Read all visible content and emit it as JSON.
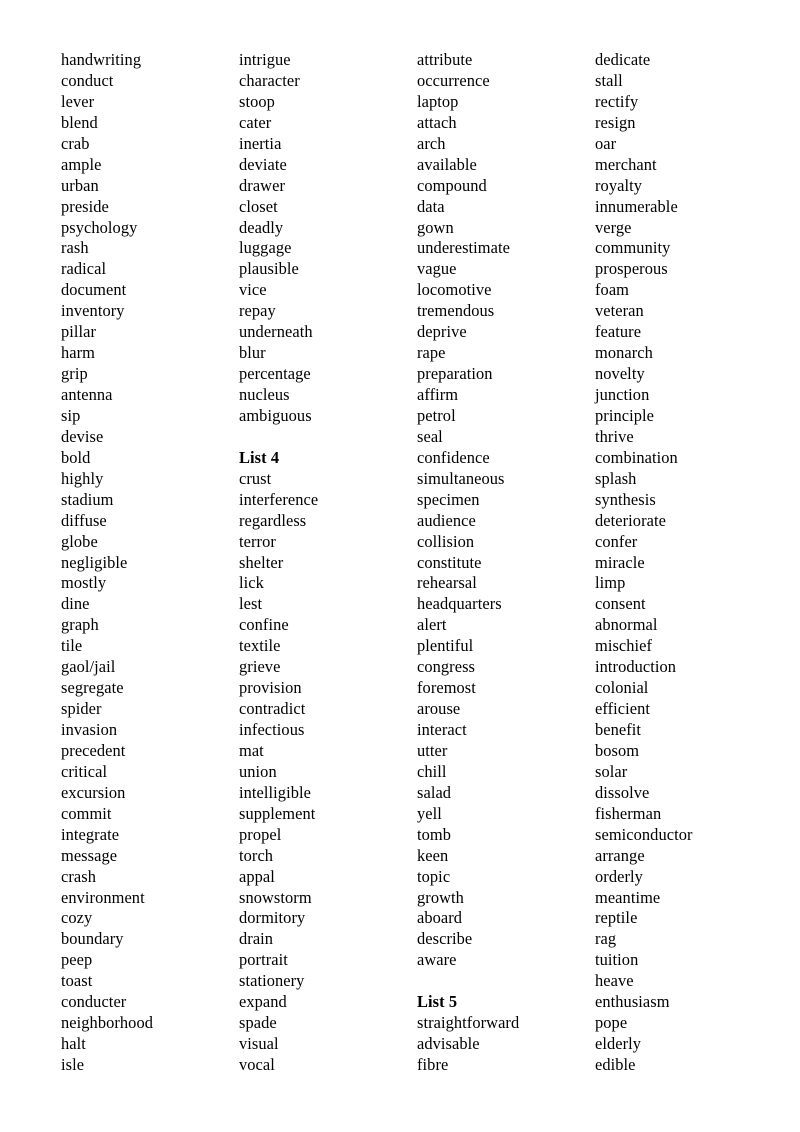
{
  "document": {
    "type": "vocabulary-word-list",
    "columns": [
      {
        "name": "column-1",
        "lines": [
          {
            "text": "handwriting",
            "style": "word"
          },
          {
            "text": "conduct",
            "style": "word"
          },
          {
            "text": "lever",
            "style": "word"
          },
          {
            "text": "blend",
            "style": "word"
          },
          {
            "text": "crab",
            "style": "word"
          },
          {
            "text": "ample",
            "style": "word"
          },
          {
            "text": "urban",
            "style": "word"
          },
          {
            "text": "preside",
            "style": "word"
          },
          {
            "text": "psychology",
            "style": "word"
          },
          {
            "text": "rash",
            "style": "word"
          },
          {
            "text": "radical",
            "style": "word"
          },
          {
            "text": "document",
            "style": "word"
          },
          {
            "text": "inventory",
            "style": "word"
          },
          {
            "text": "pillar",
            "style": "word"
          },
          {
            "text": "harm",
            "style": "word"
          },
          {
            "text": "grip",
            "style": "word"
          },
          {
            "text": "antenna",
            "style": "word"
          },
          {
            "text": "sip",
            "style": "word"
          },
          {
            "text": "devise",
            "style": "word"
          },
          {
            "text": "bold",
            "style": "word"
          },
          {
            "text": "highly",
            "style": "word"
          },
          {
            "text": "stadium",
            "style": "word"
          },
          {
            "text": "diffuse",
            "style": "word"
          },
          {
            "text": "globe",
            "style": "word"
          },
          {
            "text": "negligible",
            "style": "word"
          },
          {
            "text": "mostly",
            "style": "word"
          },
          {
            "text": "dine",
            "style": "word"
          },
          {
            "text": "graph",
            "style": "word"
          },
          {
            "text": "tile",
            "style": "word"
          },
          {
            "text": "gaol/jail",
            "style": "word"
          },
          {
            "text": "segregate",
            "style": "word"
          },
          {
            "text": "spider",
            "style": "word"
          },
          {
            "text": "invasion",
            "style": "word"
          },
          {
            "text": "precedent",
            "style": "word"
          },
          {
            "text": "critical",
            "style": "word"
          },
          {
            "text": "excursion",
            "style": "word"
          },
          {
            "text": "commit",
            "style": "word"
          },
          {
            "text": "integrate",
            "style": "word"
          },
          {
            "text": "message",
            "style": "word"
          },
          {
            "text": "crash",
            "style": "word"
          },
          {
            "text": "environment",
            "style": "word"
          },
          {
            "text": "cozy",
            "style": "word"
          },
          {
            "text": "boundary",
            "style": "word"
          },
          {
            "text": "peep",
            "style": "word"
          },
          {
            "text": "toast",
            "style": "word"
          },
          {
            "text": "conducter",
            "style": "word"
          },
          {
            "text": "neighborhood",
            "style": "word"
          },
          {
            "text": "halt",
            "style": "word"
          },
          {
            "text": "isle",
            "style": "word"
          }
        ]
      },
      {
        "name": "column-2",
        "lines": [
          {
            "text": "intrigue",
            "style": "word"
          },
          {
            "text": "character",
            "style": "word"
          },
          {
            "text": "stoop",
            "style": "word"
          },
          {
            "text": "cater",
            "style": "word"
          },
          {
            "text": "inertia",
            "style": "word"
          },
          {
            "text": "deviate",
            "style": "word"
          },
          {
            "text": "drawer",
            "style": "word"
          },
          {
            "text": "closet",
            "style": "word"
          },
          {
            "text": "deadly",
            "style": "word"
          },
          {
            "text": "luggage",
            "style": "word"
          },
          {
            "text": "plausible",
            "style": "word"
          },
          {
            "text": "vice",
            "style": "word"
          },
          {
            "text": "repay",
            "style": "word"
          },
          {
            "text": "underneath",
            "style": "word"
          },
          {
            "text": "blur",
            "style": "word"
          },
          {
            "text": "percentage",
            "style": "word"
          },
          {
            "text": "nucleus",
            "style": "word"
          },
          {
            "text": "ambiguous",
            "style": "word"
          },
          {
            "text": "",
            "style": "spacer"
          },
          {
            "text": "List 4",
            "style": "heading"
          },
          {
            "text": "crust",
            "style": "word"
          },
          {
            "text": "interference",
            "style": "word"
          },
          {
            "text": "regardless",
            "style": "word"
          },
          {
            "text": "terror",
            "style": "word"
          },
          {
            "text": "shelter",
            "style": "word"
          },
          {
            "text": "lick",
            "style": "word"
          },
          {
            "text": "lest",
            "style": "word"
          },
          {
            "text": "confine",
            "style": "word"
          },
          {
            "text": "textile",
            "style": "word"
          },
          {
            "text": "grieve",
            "style": "word"
          },
          {
            "text": "provision",
            "style": "word"
          },
          {
            "text": "contradict",
            "style": "word"
          },
          {
            "text": "infectious",
            "style": "word"
          },
          {
            "text": "mat",
            "style": "word"
          },
          {
            "text": "union",
            "style": "word"
          },
          {
            "text": "intelligible",
            "style": "word"
          },
          {
            "text": "supplement",
            "style": "word"
          },
          {
            "text": "propel",
            "style": "word"
          },
          {
            "text": "torch",
            "style": "word"
          },
          {
            "text": "appal",
            "style": "word"
          },
          {
            "text": "snowstorm",
            "style": "word"
          },
          {
            "text": "dormitory",
            "style": "word"
          },
          {
            "text": "drain",
            "style": "word"
          },
          {
            "text": "portrait",
            "style": "word"
          },
          {
            "text": "stationery",
            "style": "word"
          },
          {
            "text": "expand",
            "style": "word"
          },
          {
            "text": "spade",
            "style": "word"
          },
          {
            "text": "visual",
            "style": "word"
          },
          {
            "text": "vocal",
            "style": "word"
          }
        ]
      },
      {
        "name": "column-3",
        "lines": [
          {
            "text": "attribute",
            "style": "word"
          },
          {
            "text": "occurrence",
            "style": "word"
          },
          {
            "text": "laptop",
            "style": "word"
          },
          {
            "text": "attach",
            "style": "word"
          },
          {
            "text": "arch",
            "style": "word"
          },
          {
            "text": "available",
            "style": "word"
          },
          {
            "text": "compound",
            "style": "word"
          },
          {
            "text": "data",
            "style": "word"
          },
          {
            "text": "gown",
            "style": "word"
          },
          {
            "text": "underestimate",
            "style": "word"
          },
          {
            "text": "vague",
            "style": "word"
          },
          {
            "text": "locomotive",
            "style": "word"
          },
          {
            "text": "tremendous",
            "style": "word"
          },
          {
            "text": "deprive",
            "style": "word"
          },
          {
            "text": "rape",
            "style": "word"
          },
          {
            "text": "preparation",
            "style": "word"
          },
          {
            "text": "affirm",
            "style": "word"
          },
          {
            "text": "petrol",
            "style": "word"
          },
          {
            "text": "seal",
            "style": "word"
          },
          {
            "text": "confidence",
            "style": "word"
          },
          {
            "text": "simultaneous",
            "style": "word"
          },
          {
            "text": "specimen",
            "style": "word"
          },
          {
            "text": "audience",
            "style": "word"
          },
          {
            "text": "collision",
            "style": "word"
          },
          {
            "text": "constitute",
            "style": "word"
          },
          {
            "text": "rehearsal",
            "style": "word"
          },
          {
            "text": "headquarters",
            "style": "word"
          },
          {
            "text": "alert",
            "style": "word"
          },
          {
            "text": "plentiful",
            "style": "word"
          },
          {
            "text": "congress",
            "style": "word"
          },
          {
            "text": "foremost",
            "style": "word"
          },
          {
            "text": "arouse",
            "style": "word"
          },
          {
            "text": "interact",
            "style": "word"
          },
          {
            "text": "utter",
            "style": "word"
          },
          {
            "text": "chill",
            "style": "word"
          },
          {
            "text": "salad",
            "style": "word"
          },
          {
            "text": "yell",
            "style": "word"
          },
          {
            "text": "tomb",
            "style": "word"
          },
          {
            "text": "keen",
            "style": "word"
          },
          {
            "text": "topic",
            "style": "word"
          },
          {
            "text": "growth",
            "style": "word"
          },
          {
            "text": "aboard",
            "style": "word"
          },
          {
            "text": "describe",
            "style": "word"
          },
          {
            "text": "aware",
            "style": "word"
          },
          {
            "text": "",
            "style": "spacer"
          },
          {
            "text": "List 5",
            "style": "heading"
          },
          {
            "text": "straightforward",
            "style": "word"
          },
          {
            "text": "advisable",
            "style": "word"
          },
          {
            "text": "fibre",
            "style": "word"
          }
        ]
      },
      {
        "name": "column-4",
        "lines": [
          {
            "text": "dedicate",
            "style": "word"
          },
          {
            "text": "stall",
            "style": "word"
          },
          {
            "text": "rectify",
            "style": "word"
          },
          {
            "text": "resign",
            "style": "word"
          },
          {
            "text": "oar",
            "style": "word"
          },
          {
            "text": "merchant",
            "style": "word"
          },
          {
            "text": "royalty",
            "style": "word"
          },
          {
            "text": "innumerable",
            "style": "word"
          },
          {
            "text": "verge",
            "style": "word"
          },
          {
            "text": "community",
            "style": "word"
          },
          {
            "text": "prosperous",
            "style": "word"
          },
          {
            "text": "foam",
            "style": "word"
          },
          {
            "text": "veteran",
            "style": "word"
          },
          {
            "text": "feature",
            "style": "word"
          },
          {
            "text": "monarch",
            "style": "word"
          },
          {
            "text": "novelty",
            "style": "word"
          },
          {
            "text": "junction",
            "style": "word"
          },
          {
            "text": "principle",
            "style": "word"
          },
          {
            "text": "thrive",
            "style": "word"
          },
          {
            "text": "combination",
            "style": "word"
          },
          {
            "text": "splash",
            "style": "word"
          },
          {
            "text": "synthesis",
            "style": "word"
          },
          {
            "text": "deteriorate",
            "style": "word"
          },
          {
            "text": "confer",
            "style": "word"
          },
          {
            "text": "miracle",
            "style": "word"
          },
          {
            "text": "limp",
            "style": "word"
          },
          {
            "text": "consent",
            "style": "word"
          },
          {
            "text": "abnormal",
            "style": "word"
          },
          {
            "text": "mischief",
            "style": "word"
          },
          {
            "text": "introduction",
            "style": "word"
          },
          {
            "text": "colonial",
            "style": "word"
          },
          {
            "text": "efficient",
            "style": "word"
          },
          {
            "text": "benefit",
            "style": "word"
          },
          {
            "text": "bosom",
            "style": "word"
          },
          {
            "text": "solar",
            "style": "word"
          },
          {
            "text": "dissolve",
            "style": "word"
          },
          {
            "text": "fisherman",
            "style": "word"
          },
          {
            "text": "semiconductor",
            "style": "word"
          },
          {
            "text": "arrange",
            "style": "word"
          },
          {
            "text": "orderly",
            "style": "word"
          },
          {
            "text": "meantime",
            "style": "word"
          },
          {
            "text": "reptile",
            "style": "word"
          },
          {
            "text": "rag",
            "style": "word"
          },
          {
            "text": "tuition",
            "style": "word"
          },
          {
            "text": "heave",
            "style": "word"
          },
          {
            "text": "enthusiasm",
            "style": "word"
          },
          {
            "text": "pope",
            "style": "word"
          },
          {
            "text": "elderly",
            "style": "word"
          },
          {
            "text": "edible",
            "style": "word"
          }
        ]
      }
    ]
  }
}
